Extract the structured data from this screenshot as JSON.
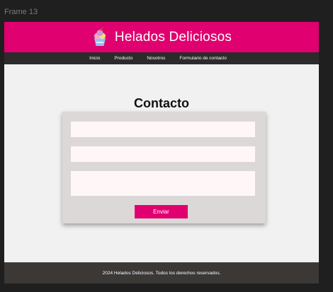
{
  "frame": {
    "label": "Frame 13"
  },
  "header": {
    "title": "Helados Deliciosos",
    "logo_icon": "ice-cream-cup-icon"
  },
  "nav": {
    "items": [
      {
        "label": "Inicio"
      },
      {
        "label": "Producto"
      },
      {
        "label": "Nosotros"
      },
      {
        "label": "Formulario de contacto"
      }
    ]
  },
  "main": {
    "title": "Contacto",
    "form": {
      "field1_value": "",
      "field2_value": "",
      "message_value": "",
      "submit_label": "Enviar"
    }
  },
  "footer": {
    "text": "2024 Helados Deliciosos. Todos los derechos reservados."
  },
  "colors": {
    "brand": "#e0006f",
    "nav_bg": "#2b2b2b",
    "footer_bg": "#3b3836",
    "card_bg": "#dcd8d7",
    "page_bg": "#f1f1f1"
  }
}
